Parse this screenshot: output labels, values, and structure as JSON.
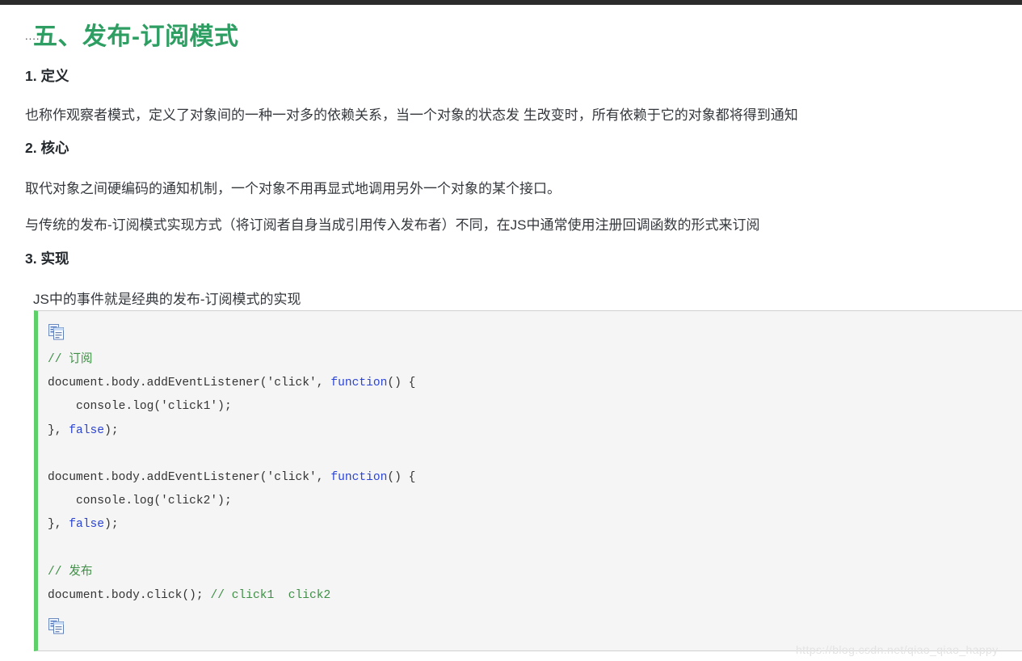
{
  "document": {
    "main_heading": "五、发布-订阅模式",
    "heading_dots": "....",
    "sections": [
      {
        "heading": "1. 定义",
        "paragraphs": [
          "也称作观察者模式，定义了对象间的一种一对多的依赖关系，当一个对象的状态发 生改变时，所有依赖于它的对象都将得到通知"
        ]
      },
      {
        "heading": "2. 核心",
        "paragraphs": [
          "取代对象之间硬编码的通知机制，一个对象不用再显式地调用另外一个对象的某个接口。",
          "与传统的发布-订阅模式实现方式（将订阅者自身当成引用传入发布者）不同，在JS中通常使用注册回调函数的形式来订阅"
        ]
      },
      {
        "heading": "3. 实现",
        "paragraphs": [
          "JS中的事件就是经典的发布-订阅模式的实现"
        ]
      }
    ]
  },
  "code_block": {
    "language": "javascript",
    "copy_icon_top": "copy-icon",
    "copy_icon_bottom": "copy-icon",
    "lines": [
      [
        {
          "t": "comment",
          "s": "// 订阅"
        }
      ],
      [
        {
          "t": "plain",
          "s": "document.body.addEventListener('click', "
        },
        {
          "t": "keyword",
          "s": "function"
        },
        {
          "t": "plain",
          "s": "() {"
        }
      ],
      [
        {
          "t": "plain",
          "s": "    console.log('click1');"
        }
      ],
      [
        {
          "t": "plain",
          "s": "}, "
        },
        {
          "t": "keyword",
          "s": "false"
        },
        {
          "t": "plain",
          "s": ");"
        }
      ],
      [
        {
          "t": "plain",
          "s": ""
        }
      ],
      [
        {
          "t": "plain",
          "s": "document.body.addEventListener('click', "
        },
        {
          "t": "keyword",
          "s": "function"
        },
        {
          "t": "plain",
          "s": "() {"
        }
      ],
      [
        {
          "t": "plain",
          "s": "    console.log('click2');"
        }
      ],
      [
        {
          "t": "plain",
          "s": "}, "
        },
        {
          "t": "keyword",
          "s": "false"
        },
        {
          "t": "plain",
          "s": ");"
        }
      ],
      [
        {
          "t": "plain",
          "s": ""
        }
      ],
      [
        {
          "t": "comment",
          "s": "// 发布"
        }
      ],
      [
        {
          "t": "plain",
          "s": "document.body.click(); "
        },
        {
          "t": "comment",
          "s": "// click1  click2"
        }
      ]
    ],
    "colors": {
      "background": "#f5f5f5",
      "left_border": "#5ed06a",
      "comment": "#3f8f46",
      "keyword": "#2b44d6",
      "plain": "#333333"
    }
  },
  "watermark": {
    "text": "https://blog.csdn.net/qiao_qiao_happy"
  },
  "theme": {
    "heading_green": "#2e9e63",
    "text_color": "#34383d",
    "top_strip": "#2b2b2b"
  }
}
